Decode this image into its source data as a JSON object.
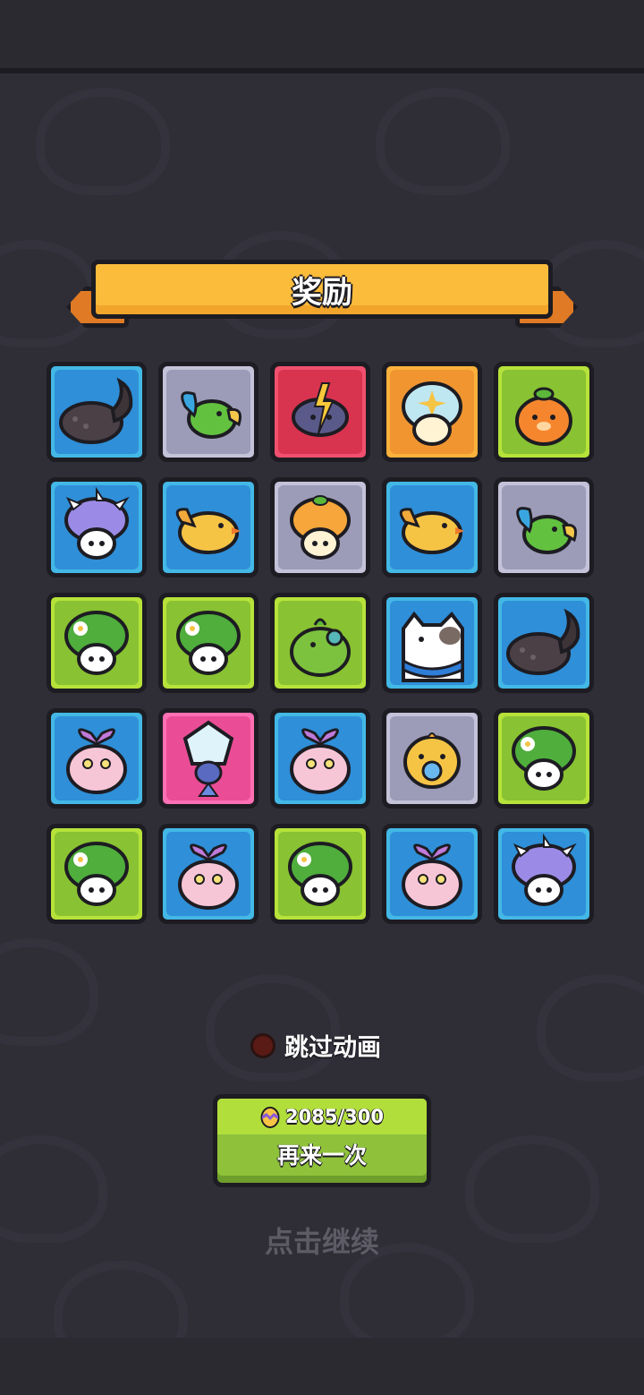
{
  "header": {
    "title": "奖励"
  },
  "rewards": [
    {
      "name": "rhino-beetle",
      "color": "blue"
    },
    {
      "name": "green-parrot",
      "color": "gray"
    },
    {
      "name": "storm-cloud",
      "color": "red"
    },
    {
      "name": "rainbow-mushroom",
      "color": "orange"
    },
    {
      "name": "orange-blob",
      "color": "green"
    },
    {
      "name": "purple-spiky-mushroom",
      "color": "blue"
    },
    {
      "name": "yellow-bird",
      "color": "blue"
    },
    {
      "name": "orange-mushroom",
      "color": "gray"
    },
    {
      "name": "yellow-bird",
      "color": "blue"
    },
    {
      "name": "green-parrot",
      "color": "gray"
    },
    {
      "name": "green-flower-mushroom",
      "color": "green"
    },
    {
      "name": "green-flower-mushroom",
      "color": "green"
    },
    {
      "name": "green-frog",
      "color": "green"
    },
    {
      "name": "calico-cat",
      "color": "blue"
    },
    {
      "name": "rhino-beetle",
      "color": "blue"
    },
    {
      "name": "pink-bow-slime",
      "color": "blue"
    },
    {
      "name": "ice-crystal-creature",
      "color": "pink"
    },
    {
      "name": "pink-bow-slime",
      "color": "blue"
    },
    {
      "name": "pacifier-chick",
      "color": "gray"
    },
    {
      "name": "green-flower-mushroom",
      "color": "green"
    },
    {
      "name": "green-flower-mushroom",
      "color": "green"
    },
    {
      "name": "pink-bow-slime",
      "color": "blue"
    },
    {
      "name": "green-flower-mushroom",
      "color": "green"
    },
    {
      "name": "pink-bow-slime",
      "color": "blue"
    },
    {
      "name": "purple-spiky-mushroom",
      "color": "blue"
    }
  ],
  "skip_animation": {
    "label": "跳过动画",
    "checked": false
  },
  "again_button": {
    "cost": "2085/300",
    "cost_icon": "egg-icon",
    "label": "再来一次"
  },
  "continue_text": "点击继续",
  "colors": {
    "background": "#2f2e37",
    "ribbon": "#fbbb3b",
    "button": "#8fc23a"
  }
}
